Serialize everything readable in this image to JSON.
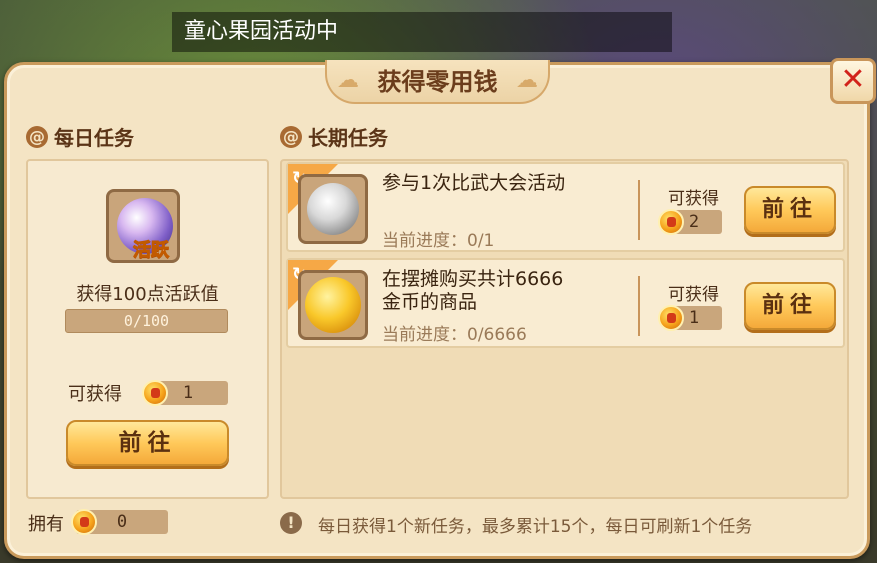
{
  "marquee": "童心果园活动中",
  "title": "获得零用钱",
  "close": "✕",
  "daily": {
    "heading": "每日任务",
    "icon_badge": "活跃",
    "description": "获得100点活跃值",
    "progress_text": "0/100",
    "progress_fraction": 0,
    "reward_label": "可获得",
    "reward_count": "1",
    "go_label": "前往"
  },
  "long_term": {
    "heading": "长期任务",
    "tasks": [
      {
        "title": "参与1次比武大会活动",
        "progress": "当前进度：0/1",
        "reward_label": "可获得",
        "reward_count": "2",
        "go_label": "前往",
        "icon": "silver-orb-icon"
      },
      {
        "title_line1": "在摆摊购买共计6666",
        "title_line2": "金币的商品",
        "progress": "当前进度：0/6666",
        "reward_label": "可获得",
        "reward_count": "1",
        "go_label": "前往",
        "icon": "gold-coin-icon"
      }
    ]
  },
  "own": {
    "label": "拥有",
    "count": "0"
  },
  "tip": "每日获得1个新任务，最多累计15个，每日可刷新1个任务"
}
